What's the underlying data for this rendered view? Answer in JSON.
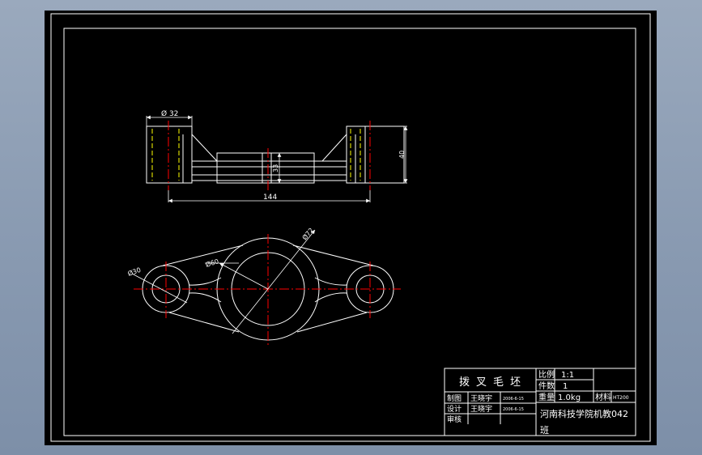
{
  "drawing": {
    "dimensions": {
      "top_view_diameter": "Ø 32",
      "overall_height": "40",
      "center_height": "33",
      "overall_length": "144",
      "large_boss": "Ø72",
      "hole": "Ø60",
      "small_boss": "Ø30"
    },
    "title_block": {
      "part_name": "拨叉毛坯",
      "scale_label": "比例",
      "scale_value": "1:1",
      "qty_label": "件数",
      "qty_value": "1",
      "weight_label": "重量",
      "weight_value": "1.0kg",
      "material_label": "材料",
      "material_value": "HT200",
      "drawn_label": "制图",
      "drawn_name": "王晓宇",
      "drawn_date": "2006-6-15",
      "designed_label": "设计",
      "designed_name": "王晓宇",
      "designed_date": "2006-6-15",
      "review_label": "审核",
      "school": "河南科技学院机教042",
      "class_suffix": "班"
    }
  },
  "colors": {
    "outline": "#ffffff",
    "center_line": "#ff0000",
    "hidden_line": "#ffff00",
    "background": "#000000"
  }
}
